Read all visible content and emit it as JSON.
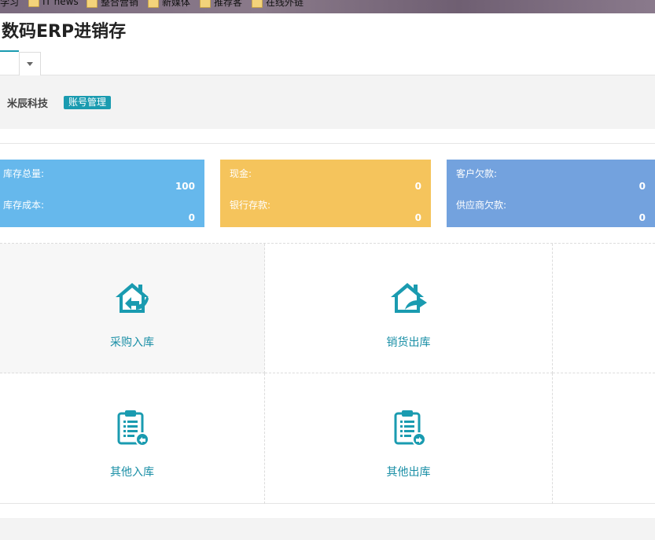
{
  "bookmarks": [
    {
      "label": "学习",
      "folder": false
    },
    {
      "label": "IT news",
      "folder": true
    },
    {
      "label": "整合营销",
      "folder": true
    },
    {
      "label": "新媒体",
      "folder": true
    },
    {
      "label": "推荐客",
      "folder": true
    },
    {
      "label": "在线外链",
      "folder": true
    }
  ],
  "app": {
    "title": "数码ERP进销存"
  },
  "company": {
    "name": "米辰科技",
    "account_badge": "账号管理"
  },
  "stats": {
    "inventory_total_label": "库存总量:",
    "inventory_total_value": "100",
    "inventory_cost_label": "库存成本:",
    "inventory_cost_value": "0",
    "cash_label": "现金:",
    "cash_value": "0",
    "bank_label": "银行存款:",
    "bank_value": "0",
    "customer_debt_label": "客户欠款:",
    "customer_debt_value": "0",
    "supplier_debt_label": "供应商欠款:",
    "supplier_debt_value": "0"
  },
  "functions": {
    "purchase_in": "采购入库",
    "sales_out": "销货出库",
    "other_in": "其他入库",
    "other_out": "其他出库"
  },
  "colors": {
    "accent": "#1a9bb0",
    "card_blue": "#66b8ec",
    "card_yellow": "#f5c45c",
    "card_indigo": "#73a2de"
  },
  "icons": {
    "purchase_in": "house-arrow-in-icon",
    "sales_out": "house-arrow-out-icon",
    "other_in": "clipboard-in-icon",
    "other_out": "clipboard-out-icon",
    "tab_menu": "caret-down-icon"
  }
}
